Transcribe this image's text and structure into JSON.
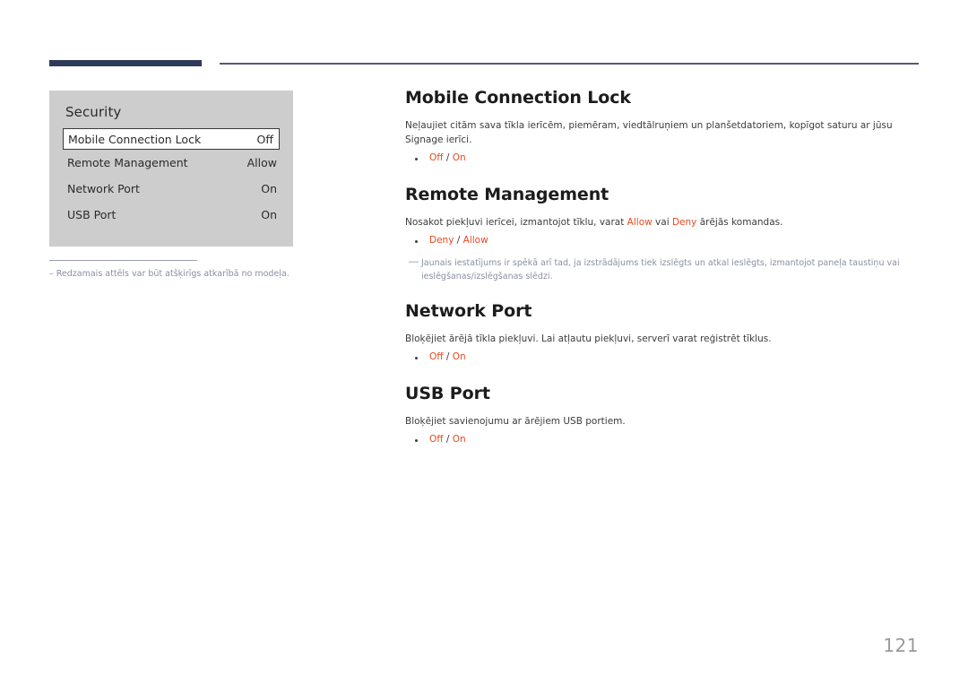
{
  "page": {
    "number": "121"
  },
  "device_screenshot": {
    "title": "Security",
    "rows": [
      {
        "label": "Mobile Connection Lock",
        "value": "Off",
        "selected": true
      },
      {
        "label": "Remote Management",
        "value": "Allow",
        "selected": false
      },
      {
        "label": "Network Port",
        "value": "On",
        "selected": false
      },
      {
        "label": "USB Port",
        "value": "On",
        "selected": false
      }
    ],
    "note": {
      "dash": "–",
      "text": "Redzamais attēls var būt atšķirīgs atkarībā no modeļa."
    }
  },
  "sections": [
    {
      "title": "Mobile Connection Lock",
      "body_parts": [
        {
          "text": "Neļaujiet citām sava tīkla ierīcēm, piemēram, viedtālruņiem un planšetdatoriem, kopīgot saturu ar jūsu Signage ierīci.",
          "highlight": false
        }
      ],
      "options": [
        {
          "first": "Off",
          "sep": " / ",
          "second": "On"
        }
      ],
      "tip": null
    },
    {
      "title": "Remote Management",
      "body_parts": [
        {
          "text": "Nosakot piekļuvi ierīcei, izmantojot tīklu, varat ",
          "highlight": false
        },
        {
          "text": "Allow",
          "highlight": true
        },
        {
          "text": " vai ",
          "highlight": false
        },
        {
          "text": "Deny",
          "highlight": true
        },
        {
          "text": " ārējās komandas.",
          "highlight": false
        }
      ],
      "options": [
        {
          "first": "Deny",
          "sep": " / ",
          "second": "Allow"
        }
      ],
      "tip": {
        "dash": "―",
        "text": "Jaunais iestatījums ir spēkā arī tad, ja izstrādājums tiek izslēgts un atkal ieslēgts, izmantojot paneļa taustiņu vai ieslēgšanas/izslēgšanas slēdzi."
      }
    },
    {
      "title": "Network Port",
      "body_parts": [
        {
          "text": "Bloķējiet ārējā tīkla piekļuvi. Lai atļautu piekļuvi, serverī varat reģistrēt tīklus.",
          "highlight": false
        }
      ],
      "options": [
        {
          "first": "Off",
          "sep": " / ",
          "second": "On"
        }
      ],
      "tip": null
    },
    {
      "title": "USB Port",
      "body_parts": [
        {
          "text": "Bloķējiet savienojumu ar ārējiem USB portiem.",
          "highlight": false
        }
      ],
      "options": [
        {
          "first": "Off",
          "sep": " / ",
          "second": "On"
        }
      ],
      "tip": null
    }
  ],
  "colors": {
    "header_bar": "#2e3a59",
    "header_rule": "#575a73",
    "highlight": "#e8491f",
    "note_text": "#8a8fa3",
    "panel_bg": "#cdcdcd",
    "page_number": "#9a9a9a"
  }
}
